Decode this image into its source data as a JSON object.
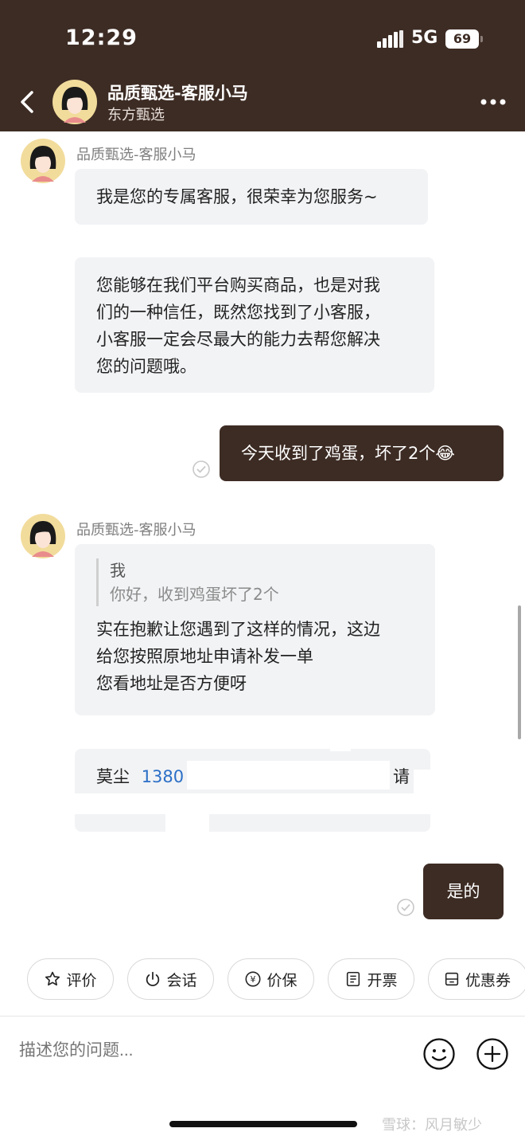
{
  "status_bar": {
    "time": "12:29",
    "network": "5G",
    "battery": "69"
  },
  "header": {
    "title": "品质甄选-客服小马",
    "subtitle": "东方甄选"
  },
  "messages": [
    {
      "sender": "品质甄选-客服小马",
      "text": "我是您的专属客服，很荣幸为您服务~"
    },
    {
      "lines": [
        "您能够在我们平台购买商品，也是对我",
        "们的一种信任，既然您找到了小客服，",
        "小客服一定会尽最大的能力去帮您解决",
        "您的问题哦。"
      ]
    },
    {
      "text": "今天收到了鸡蛋，坏了2个😂"
    },
    {
      "sender": "品质甄选-客服小马",
      "quote_name": "我",
      "quote_text": "你好，收到鸡蛋坏了2个",
      "lines": [
        "实在抱歉让您遇到了这样的情况，这边",
        "给您按照原地址申请补发一单",
        "您看地址是否方便呀"
      ]
    },
    {
      "name": "莫尘",
      "phone": "1380",
      "fragment": "请"
    },
    {
      "text": "是的"
    }
  ],
  "quick_actions": [
    {
      "label": "评价",
      "icon": "star-icon"
    },
    {
      "label": "会话",
      "icon": "power-icon"
    },
    {
      "label": "价保",
      "icon": "price-protect-icon"
    },
    {
      "label": "开票",
      "icon": "invoice-icon"
    },
    {
      "label": "优惠券",
      "icon": "coupon-icon"
    }
  ],
  "input": {
    "placeholder": "描述您的问题..."
  },
  "watermark": "雪球：风月敏少",
  "colors": {
    "header_bg": "#3d2c24",
    "outgoing_bubble": "#3d2c24",
    "incoming_bubble": "#f2f3f5",
    "link": "#2b6fc7"
  }
}
